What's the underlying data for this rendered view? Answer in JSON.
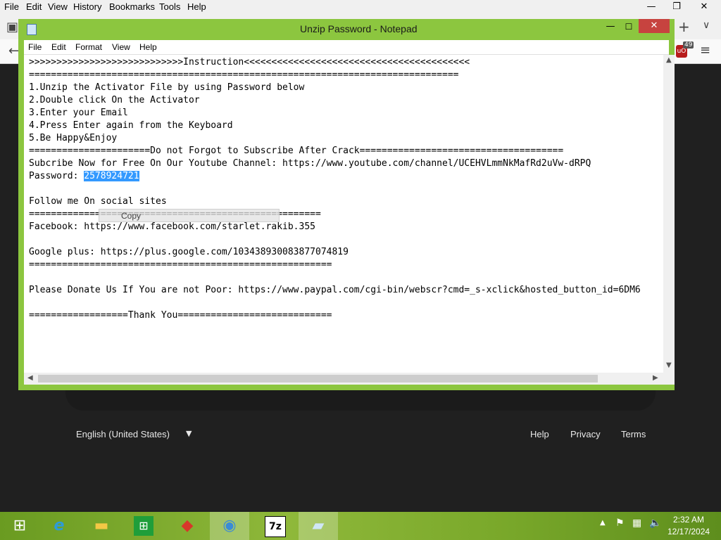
{
  "browser": {
    "menu": [
      "File",
      "Edit",
      "View",
      "History",
      "Bookmarks",
      "Tools",
      "Help"
    ],
    "badge_count": "49",
    "footer": {
      "language": "English (United States)",
      "links": [
        "Help",
        "Privacy",
        "Terms"
      ]
    }
  },
  "notepad": {
    "title": "Unzip Password - Notepad",
    "menu": [
      "File",
      "Edit",
      "Format",
      "View",
      "Help"
    ],
    "lines": [
      ">>>>>>>>>>>>>>>>>>>>>>>>>>>>Instruction<<<<<<<<<<<<<<<<<<<<<<<<<<<<<<<<<<<<<<<<<",
      "==============================================================================",
      "1.Unzip the Activator File by using Password below",
      "2.Double click On the Activator",
      "3.Enter your Email",
      "4.Press Enter again from the Keyboard",
      "5.Be Happy&Enjoy",
      "======================Do not Forgot to Subscribe After Crack=====================================",
      "Subcribe Now for Free On Our Youtube Channel: https://www.youtube.com/channel/UCEHVLmmNkMafRd2uVw-dRPQ",
      "Password: ",
      "",
      "Follow me On social sites",
      "=====================================================",
      "Facebook: https://www.facebook.com/starlet.rakib.355",
      "",
      "Google plus: https://plus.google.com/103438930083877074819",
      "=======================================================",
      "",
      "Please Donate Us If You are not Poor: https://www.paypal.com/cgi-bin/webscr?cmd=_s-xclick&hosted_button_id=6DM6",
      "",
      "==================Thank You============================"
    ],
    "password": "2578924721",
    "tooltip": "Copy"
  },
  "taskbar": {
    "apps": [
      "start",
      "internet-explorer",
      "file-explorer",
      "store",
      "app-red",
      "browser-globe",
      "7zip",
      "notepad"
    ],
    "clock_time": "2:32 AM",
    "clock_date": "12/17/2024"
  }
}
